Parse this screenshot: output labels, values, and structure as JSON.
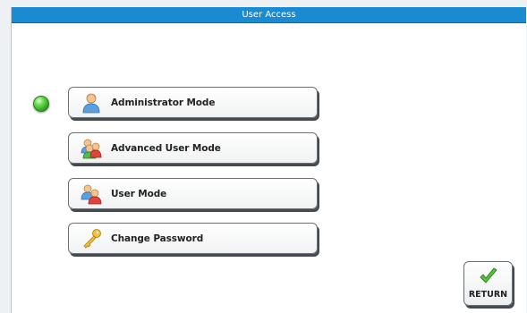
{
  "window": {
    "title": "User Access"
  },
  "menu": {
    "items": [
      {
        "label": "Administrator Mode",
        "icon": "single-user-icon"
      },
      {
        "label": "Advanced User Mode",
        "icon": "multi-user-icon"
      },
      {
        "label": "User Mode",
        "icon": "user-group-icon"
      },
      {
        "label": "Change Password",
        "icon": "key-icon"
      }
    ],
    "active_indicator_color": "#3cb02a"
  },
  "return_button": {
    "label": "RETURN",
    "icon": "checkmark-icon"
  }
}
